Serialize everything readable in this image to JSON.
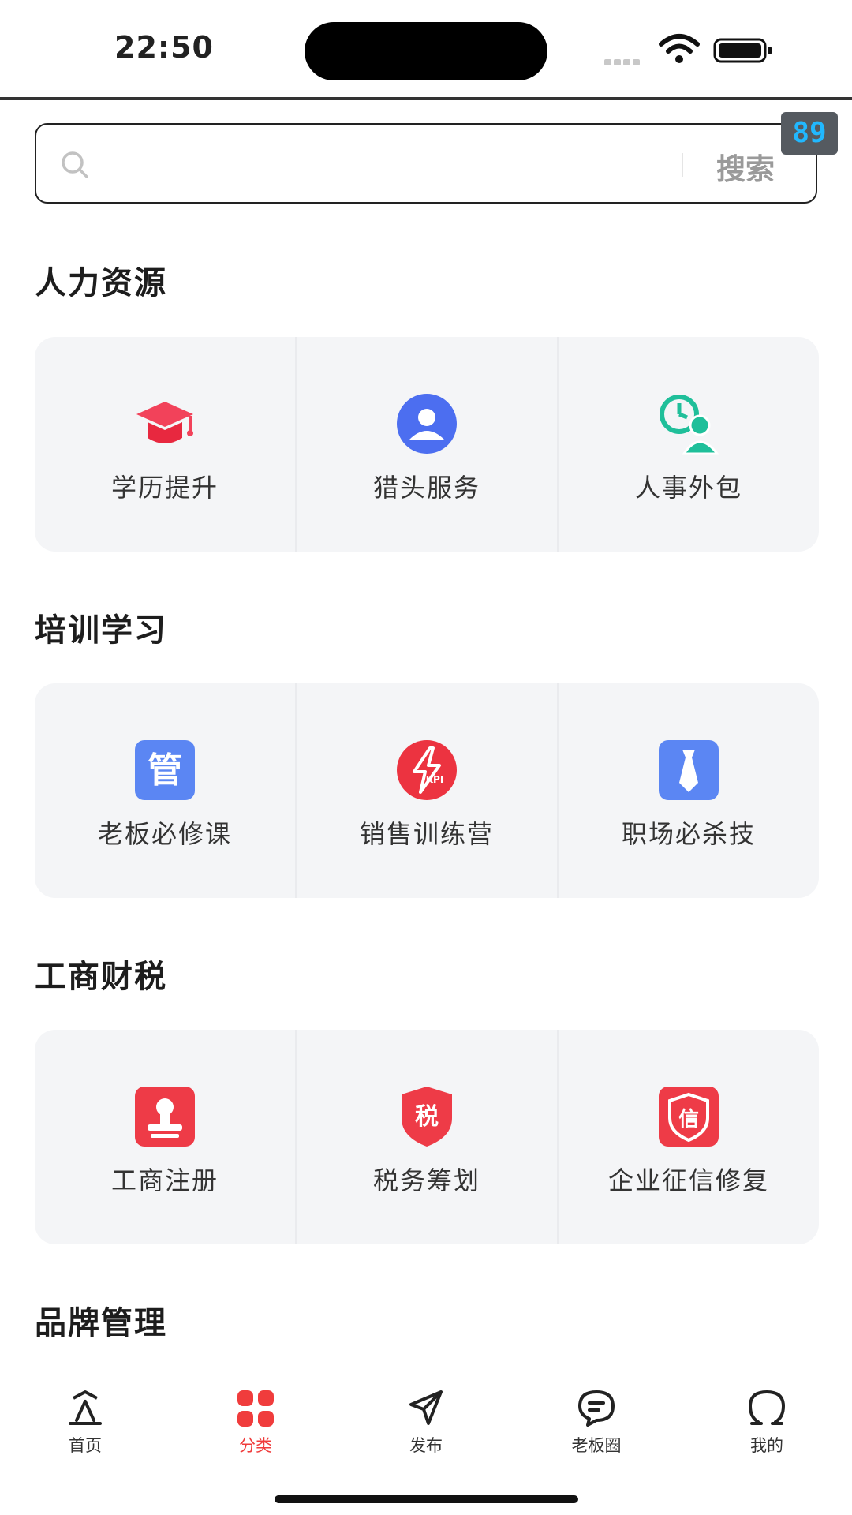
{
  "status": {
    "time": "22:50"
  },
  "search": {
    "placeholder": "",
    "button_label": "搜索",
    "badge": "89"
  },
  "sections": [
    {
      "title": "人力资源",
      "items": [
        {
          "label": "学历提升",
          "icon": "graduation-cap-icon"
        },
        {
          "label": "猎头服务",
          "icon": "person-icon"
        },
        {
          "label": "人事外包",
          "icon": "clock-person-icon"
        }
      ]
    },
    {
      "title": "培训学习",
      "items": [
        {
          "label": "老板必修课",
          "icon": "manage-icon",
          "icon_text": "管"
        },
        {
          "label": "销售训练营",
          "icon": "kpi-bolt-icon",
          "icon_text": "KPI"
        },
        {
          "label": "职场必杀技",
          "icon": "tie-icon"
        }
      ]
    },
    {
      "title": "工商财税",
      "items": [
        {
          "label": "工商注册",
          "icon": "stamp-icon"
        },
        {
          "label": "税务筹划",
          "icon": "tax-shield-icon",
          "icon_text": "税"
        },
        {
          "label": "企业征信修复",
          "icon": "credit-shield-icon",
          "icon_text": "信"
        }
      ]
    },
    {
      "title": "品牌管理"
    }
  ],
  "tabbar": {
    "items": [
      {
        "label": "首页",
        "icon": "home-icon"
      },
      {
        "label": "分类",
        "icon": "category-icon",
        "active": true
      },
      {
        "label": "发布",
        "icon": "send-icon"
      },
      {
        "label": "老板圈",
        "icon": "chat-icon"
      },
      {
        "label": "我的",
        "icon": "profile-icon"
      }
    ]
  },
  "colors": {
    "accent": "#f03c3c",
    "badge_text": "#21b8ff",
    "card_bg": "#f4f5f7"
  }
}
